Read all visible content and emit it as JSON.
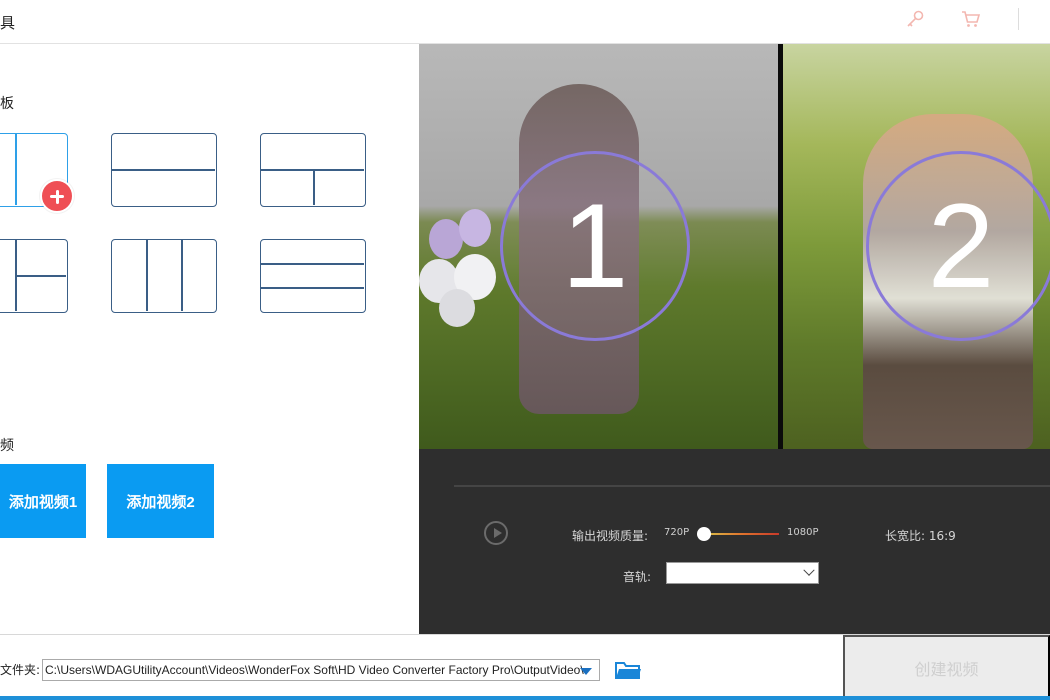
{
  "window": {
    "title": "具"
  },
  "left": {
    "template_section_label": "板",
    "video_section_label": "频",
    "add_video1_label": "添加视频1",
    "add_video2_label": "添加视频2"
  },
  "preview": {
    "clip1_number": "1",
    "clip2_number": "2"
  },
  "controls": {
    "quality_label": "输出视频质量:",
    "quality_min": "720P",
    "quality_max": "1080P",
    "quality_value": 0,
    "aspect_label": "长宽比: 16:9",
    "audio_label": "音轨:",
    "audio_value": ""
  },
  "bottom": {
    "folder_label": "文件夹:",
    "output_path": "C:\\Users\\WDAGUtilityAccount\\Videos\\WonderFox Soft\\HD Video Converter Factory Pro\\OutputVideo\\",
    "create_label": "创建视频"
  },
  "colors": {
    "accent": "#0a9bf2",
    "template_border": "#3a5e86",
    "selected_border": "#2ea0e8",
    "plus_red": "#ef4f55",
    "dark_panel": "#2e2e2e",
    "circle_border": "#8a7ad8"
  },
  "icons": {
    "key": "key-icon",
    "cart": "cart-icon",
    "plus": "plus-icon",
    "play": "play-icon",
    "folder": "folder-icon",
    "dropdown": "chevron-down-icon"
  }
}
